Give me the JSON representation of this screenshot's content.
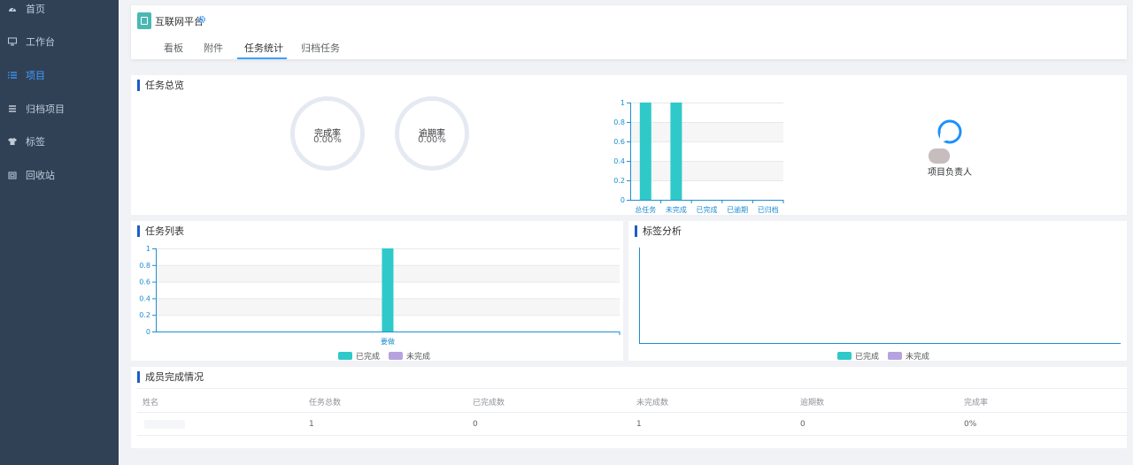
{
  "sidebar": {
    "items": [
      {
        "label": "首页",
        "icon": "dashboard-icon"
      },
      {
        "label": "工作台",
        "icon": "monitor-icon"
      },
      {
        "label": "项目",
        "icon": "list-icon",
        "active": true
      },
      {
        "label": "归档项目",
        "icon": "archive-icon"
      },
      {
        "label": "标签",
        "icon": "tshirt-icon"
      },
      {
        "label": "回收站",
        "icon": "recycle-icon"
      }
    ]
  },
  "header": {
    "project_title": "互联网平台",
    "tabs": [
      "看板",
      "附件",
      "任务统计",
      "归档任务"
    ],
    "active_tab": "任务统计"
  },
  "overview": {
    "title": "任务总览",
    "completion_label": "完成率",
    "completion_value": "0.00%",
    "overdue_label": "逾期率",
    "overdue_value": "0.00%",
    "owner_label": "项目负责人"
  },
  "task_list": {
    "title": "任务列表"
  },
  "tag_analysis": {
    "title": "标签分析"
  },
  "legend": {
    "done": "已完成",
    "undone": "未完成"
  },
  "colors": {
    "teal": "#2fc9c9",
    "purple": "#b6a2de",
    "accent": "#409eff",
    "sidebar": "#304156"
  },
  "chart_data": [
    {
      "type": "bar",
      "categories": [
        "总任务",
        "未完成",
        "已完成",
        "已逾期",
        "已归档"
      ],
      "values": [
        1,
        1,
        0,
        0,
        0
      ],
      "ylim": [
        0,
        1
      ],
      "yticks": [
        "0",
        "0.2",
        "0.4",
        "0.6",
        "0.8",
        "1"
      ]
    },
    {
      "type": "bar",
      "categories": [
        "要做"
      ],
      "series": [
        {
          "name": "已完成",
          "values": [
            1
          ]
        },
        {
          "name": "未完成",
          "values": [
            0
          ]
        }
      ],
      "ylim": [
        0,
        1
      ],
      "yticks": [
        "0",
        "0.2",
        "0.4",
        "0.6",
        "0.8",
        "1"
      ]
    },
    {
      "type": "bar",
      "categories": [],
      "series": [
        {
          "name": "已完成",
          "values": []
        },
        {
          "name": "未完成",
          "values": []
        }
      ]
    }
  ],
  "members": {
    "title": "成员完成情况",
    "columns": [
      "姓名",
      "任务总数",
      "已完成数",
      "未完成数",
      "逾期数",
      "完成率"
    ],
    "rows": [
      {
        "name": "",
        "total": "1",
        "done": "0",
        "undone": "1",
        "overdue": "0",
        "rate": "0%"
      }
    ]
  }
}
